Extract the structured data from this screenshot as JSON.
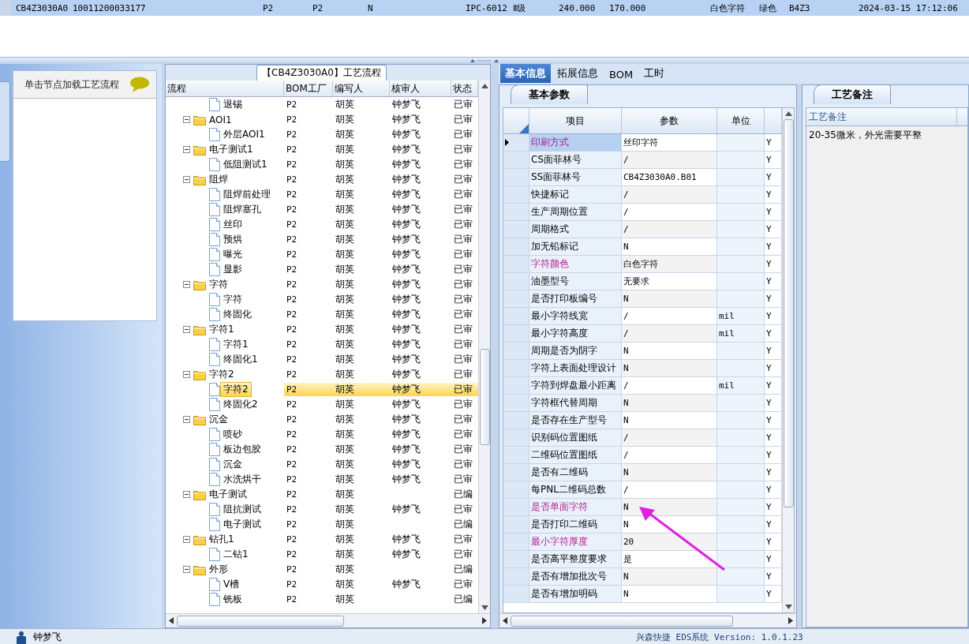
{
  "record_row": {
    "selected": true,
    "cells": [
      "CB4Z3030A0",
      "10011200033177",
      "P2",
      "P2",
      "N",
      "IPC-6012 Ⅱ级",
      "240.000",
      "170.000",
      "白色字符",
      "绿色",
      "B4Z3",
      "2024-03-15 17:12:06"
    ]
  },
  "left_panel": {
    "hint": "单击节点加载工艺流程"
  },
  "process_panel": {
    "title": "【CB4Z3030A0】工艺流程",
    "columns": [
      "流程",
      "BOM工厂",
      "编写人",
      "核审人",
      "状态"
    ],
    "nodes": [
      {
        "kind": "file",
        "name": "退锡",
        "bom": "P2",
        "writer": "胡英",
        "reviewer": "钟梦飞",
        "status": "已审",
        "selected": false
      },
      {
        "kind": "folder",
        "name": "AOI1",
        "bom": "P2",
        "writer": "胡英",
        "reviewer": "钟梦飞",
        "status": "已审",
        "selected": false,
        "expanded": true,
        "children": [
          {
            "kind": "file",
            "name": "外层AOI1",
            "bom": "P2",
            "writer": "胡英",
            "reviewer": "钟梦飞",
            "status": "已审",
            "selected": false
          }
        ]
      },
      {
        "kind": "folder",
        "name": "电子测试1",
        "bom": "P2",
        "writer": "胡英",
        "reviewer": "钟梦飞",
        "status": "已审",
        "selected": false,
        "expanded": true,
        "children": [
          {
            "kind": "file",
            "name": "低阻测试1",
            "bom": "P2",
            "writer": "胡英",
            "reviewer": "钟梦飞",
            "status": "已审",
            "selected": false
          }
        ]
      },
      {
        "kind": "folder",
        "name": "阻焊",
        "bom": "P2",
        "writer": "胡英",
        "reviewer": "钟梦飞",
        "status": "已审",
        "selected": false,
        "expanded": true,
        "children": [
          {
            "kind": "file",
            "name": "阻焊前处理",
            "bom": "P2",
            "writer": "胡英",
            "reviewer": "钟梦飞",
            "status": "已审",
            "selected": false
          },
          {
            "kind": "file",
            "name": "阻焊塞孔",
            "bom": "P2",
            "writer": "胡英",
            "reviewer": "钟梦飞",
            "status": "已审",
            "selected": false
          },
          {
            "kind": "file",
            "name": "丝印",
            "bom": "P2",
            "writer": "胡英",
            "reviewer": "钟梦飞",
            "status": "已审",
            "selected": false
          },
          {
            "kind": "file",
            "name": "预烘",
            "bom": "P2",
            "writer": "胡英",
            "reviewer": "钟梦飞",
            "status": "已审",
            "selected": false
          },
          {
            "kind": "file",
            "name": "曝光",
            "bom": "P2",
            "writer": "胡英",
            "reviewer": "钟梦飞",
            "status": "已审",
            "selected": false
          },
          {
            "kind": "file",
            "name": "显影",
            "bom": "P2",
            "writer": "胡英",
            "reviewer": "钟梦飞",
            "status": "已审",
            "selected": false
          }
        ]
      },
      {
        "kind": "folder",
        "name": "字符",
        "bom": "P2",
        "writer": "胡英",
        "reviewer": "钟梦飞",
        "status": "已审",
        "selected": false,
        "expanded": true,
        "children": [
          {
            "kind": "file",
            "name": "字符",
            "bom": "P2",
            "writer": "胡英",
            "reviewer": "钟梦飞",
            "status": "已审",
            "selected": false
          },
          {
            "kind": "file",
            "name": "终固化",
            "bom": "P2",
            "writer": "胡英",
            "reviewer": "钟梦飞",
            "status": "已审",
            "selected": false
          }
        ]
      },
      {
        "kind": "folder",
        "name": "字符1",
        "bom": "P2",
        "writer": "胡英",
        "reviewer": "钟梦飞",
        "status": "已审",
        "selected": false,
        "expanded": true,
        "children": [
          {
            "kind": "file",
            "name": "字符1",
            "bom": "P2",
            "writer": "胡英",
            "reviewer": "钟梦飞",
            "status": "已审",
            "selected": false
          },
          {
            "kind": "file",
            "name": "终固化1",
            "bom": "P2",
            "writer": "胡英",
            "reviewer": "钟梦飞",
            "status": "已审",
            "selected": false
          }
        ]
      },
      {
        "kind": "folder",
        "name": "字符2",
        "bom": "P2",
        "writer": "胡英",
        "reviewer": "钟梦飞",
        "status": "已审",
        "selected": false,
        "expanded": true,
        "children": [
          {
            "kind": "file",
            "name": "字符2",
            "bom": "P2",
            "writer": "胡英",
            "reviewer": "钟梦飞",
            "status": "已审",
            "selected": true
          },
          {
            "kind": "file",
            "name": "终固化2",
            "bom": "P2",
            "writer": "胡英",
            "reviewer": "钟梦飞",
            "status": "已审",
            "selected": false
          }
        ]
      },
      {
        "kind": "folder",
        "name": "沉金",
        "bom": "P2",
        "writer": "胡英",
        "reviewer": "钟梦飞",
        "status": "已审",
        "selected": false,
        "expanded": true,
        "children": [
          {
            "kind": "file",
            "name": "喷砂",
            "bom": "P2",
            "writer": "胡英",
            "reviewer": "钟梦飞",
            "status": "已审",
            "selected": false
          },
          {
            "kind": "file",
            "name": "板边包胶",
            "bom": "P2",
            "writer": "胡英",
            "reviewer": "钟梦飞",
            "status": "已审",
            "selected": false
          },
          {
            "kind": "file",
            "name": "沉金",
            "bom": "P2",
            "writer": "胡英",
            "reviewer": "钟梦飞",
            "status": "已审",
            "selected": false
          },
          {
            "kind": "file",
            "name": "水洗烘干",
            "bom": "P2",
            "writer": "胡英",
            "reviewer": "钟梦飞",
            "status": "已审",
            "selected": false
          }
        ]
      },
      {
        "kind": "folder",
        "name": "电子测试",
        "bom": "P2",
        "writer": "胡英",
        "status": "已编",
        "selected": false,
        "expanded": true,
        "children": [
          {
            "kind": "file",
            "name": "阻抗测试",
            "bom": "P2",
            "writer": "胡英",
            "reviewer": "钟梦飞",
            "status": "已审",
            "selected": false
          },
          {
            "kind": "file",
            "name": "电子测试",
            "bom": "P2",
            "writer": "胡英",
            "status": "已编",
            "selected": false
          }
        ]
      },
      {
        "kind": "folder",
        "name": "钻孔1",
        "bom": "P2",
        "writer": "胡英",
        "reviewer": "钟梦飞",
        "status": "已审",
        "selected": false,
        "expanded": true,
        "children": [
          {
            "kind": "file",
            "name": "二钻1",
            "bom": "P2",
            "writer": "胡英",
            "reviewer": "钟梦飞",
            "status": "已审",
            "selected": false
          }
        ]
      },
      {
        "kind": "folder",
        "name": "外形",
        "bom": "P2",
        "writer": "胡英",
        "status": "已编",
        "selected": false,
        "expanded": true,
        "children": [
          {
            "kind": "file",
            "name": "V槽",
            "bom": "P2",
            "writer": "胡英",
            "reviewer": "钟梦飞",
            "status": "已审",
            "selected": false
          },
          {
            "kind": "file",
            "name": "铣板",
            "bom": "P2",
            "writer": "胡英",
            "status": "已编",
            "selected": false
          }
        ]
      }
    ]
  },
  "tabs": [
    {
      "label": "基本信息",
      "selected": true
    },
    {
      "label": "拓展信息",
      "selected": false
    },
    {
      "label": "BOM",
      "selected": false
    },
    {
      "label": "工时",
      "selected": false
    }
  ],
  "params_panel": {
    "title": "基本参数",
    "columns": [
      "项目",
      "参数",
      "单位"
    ],
    "rows": [
      {
        "item": "印刷方式",
        "value": "丝印字符",
        "flag": "Y",
        "highlighted": true,
        "selected": true
      },
      {
        "item": "CS面菲林号",
        "value": "/",
        "flag": "Y",
        "highlighted": false,
        "selected": false
      },
      {
        "item": "SS面菲林号",
        "value": "CB4Z3030A0.B01",
        "flag": "Y",
        "highlighted": false,
        "selected": false
      },
      {
        "item": "快捷标记",
        "value": "/",
        "flag": "Y",
        "highlighted": false,
        "selected": false
      },
      {
        "item": "生产周期位置",
        "value": "/",
        "flag": "Y",
        "highlighted": false,
        "selected": false
      },
      {
        "item": "周期格式",
        "value": "/",
        "flag": "Y",
        "highlighted": false,
        "selected": false
      },
      {
        "item": "加无铅标记",
        "value": "N",
        "flag": "Y",
        "highlighted": false,
        "selected": false
      },
      {
        "item": "字符颜色",
        "value": "白色字符",
        "flag": "Y",
        "highlighted": true,
        "selected": false
      },
      {
        "item": "油墨型号",
        "value": "无要求",
        "flag": "Y",
        "highlighted": false,
        "selected": false
      },
      {
        "item": "是否打印板编号",
        "value": "N",
        "flag": "Y",
        "highlighted": false,
        "selected": false
      },
      {
        "item": "最小字符线宽",
        "value": "/",
        "unit": "mil",
        "flag": "Y",
        "highlighted": false,
        "selected": false
      },
      {
        "item": "最小字符高度",
        "value": "/",
        "unit": "mil",
        "flag": "Y",
        "highlighted": false,
        "selected": false
      },
      {
        "item": "周期是否为阴字",
        "value": "N",
        "flag": "Y",
        "highlighted": false,
        "selected": false
      },
      {
        "item": "字符上表面处理设计",
        "value": "N",
        "flag": "Y",
        "highlighted": false,
        "selected": false
      },
      {
        "item": "字符到焊盘最小距离",
        "value": "/",
        "unit": "mil",
        "flag": "Y",
        "highlighted": false,
        "selected": false
      },
      {
        "item": "字符框代替周期",
        "value": "N",
        "flag": "Y",
        "highlighted": false,
        "selected": false
      },
      {
        "item": "是否存在生产型号",
        "value": "N",
        "flag": "Y",
        "highlighted": false,
        "selected": false
      },
      {
        "item": "识别码位置图纸",
        "value": "/",
        "flag": "Y",
        "highlighted": false,
        "selected": false
      },
      {
        "item": "二维码位置图纸",
        "value": "/",
        "flag": "Y",
        "highlighted": false,
        "selected": false
      },
      {
        "item": "是否有二维码",
        "value": "N",
        "flag": "Y",
        "highlighted": false,
        "selected": false
      },
      {
        "item": "每PNL二维码总数",
        "value": "/",
        "flag": "Y",
        "highlighted": false,
        "selected": false
      },
      {
        "item": "是否单面字符",
        "value": "N",
        "flag": "Y",
        "highlighted": true,
        "selected": false
      },
      {
        "item": "是否打印二维码",
        "value": "N",
        "flag": "Y",
        "highlighted": false,
        "selected": false
      },
      {
        "item": "最小字符厚度",
        "value": "20",
        "flag": "Y",
        "highlighted": true,
        "selected": false
      },
      {
        "item": "是否高平整度要求",
        "value": "是",
        "flag": "Y",
        "highlighted": false,
        "selected": false
      },
      {
        "item": "是否有增加批次号",
        "value": "N",
        "flag": "Y",
        "highlighted": false,
        "selected": false
      },
      {
        "item": "是否有增加明码",
        "value": "N",
        "flag": "Y",
        "highlighted": false,
        "selected": false
      }
    ]
  },
  "notes_panel": {
    "title": "工艺备注",
    "column": "工艺备注",
    "note": "20-35微米，外光需要平整"
  },
  "status_bar": {
    "user": "钟梦飞",
    "version": "兴森快捷 EDS系统 Version: 1.0.1.23"
  }
}
